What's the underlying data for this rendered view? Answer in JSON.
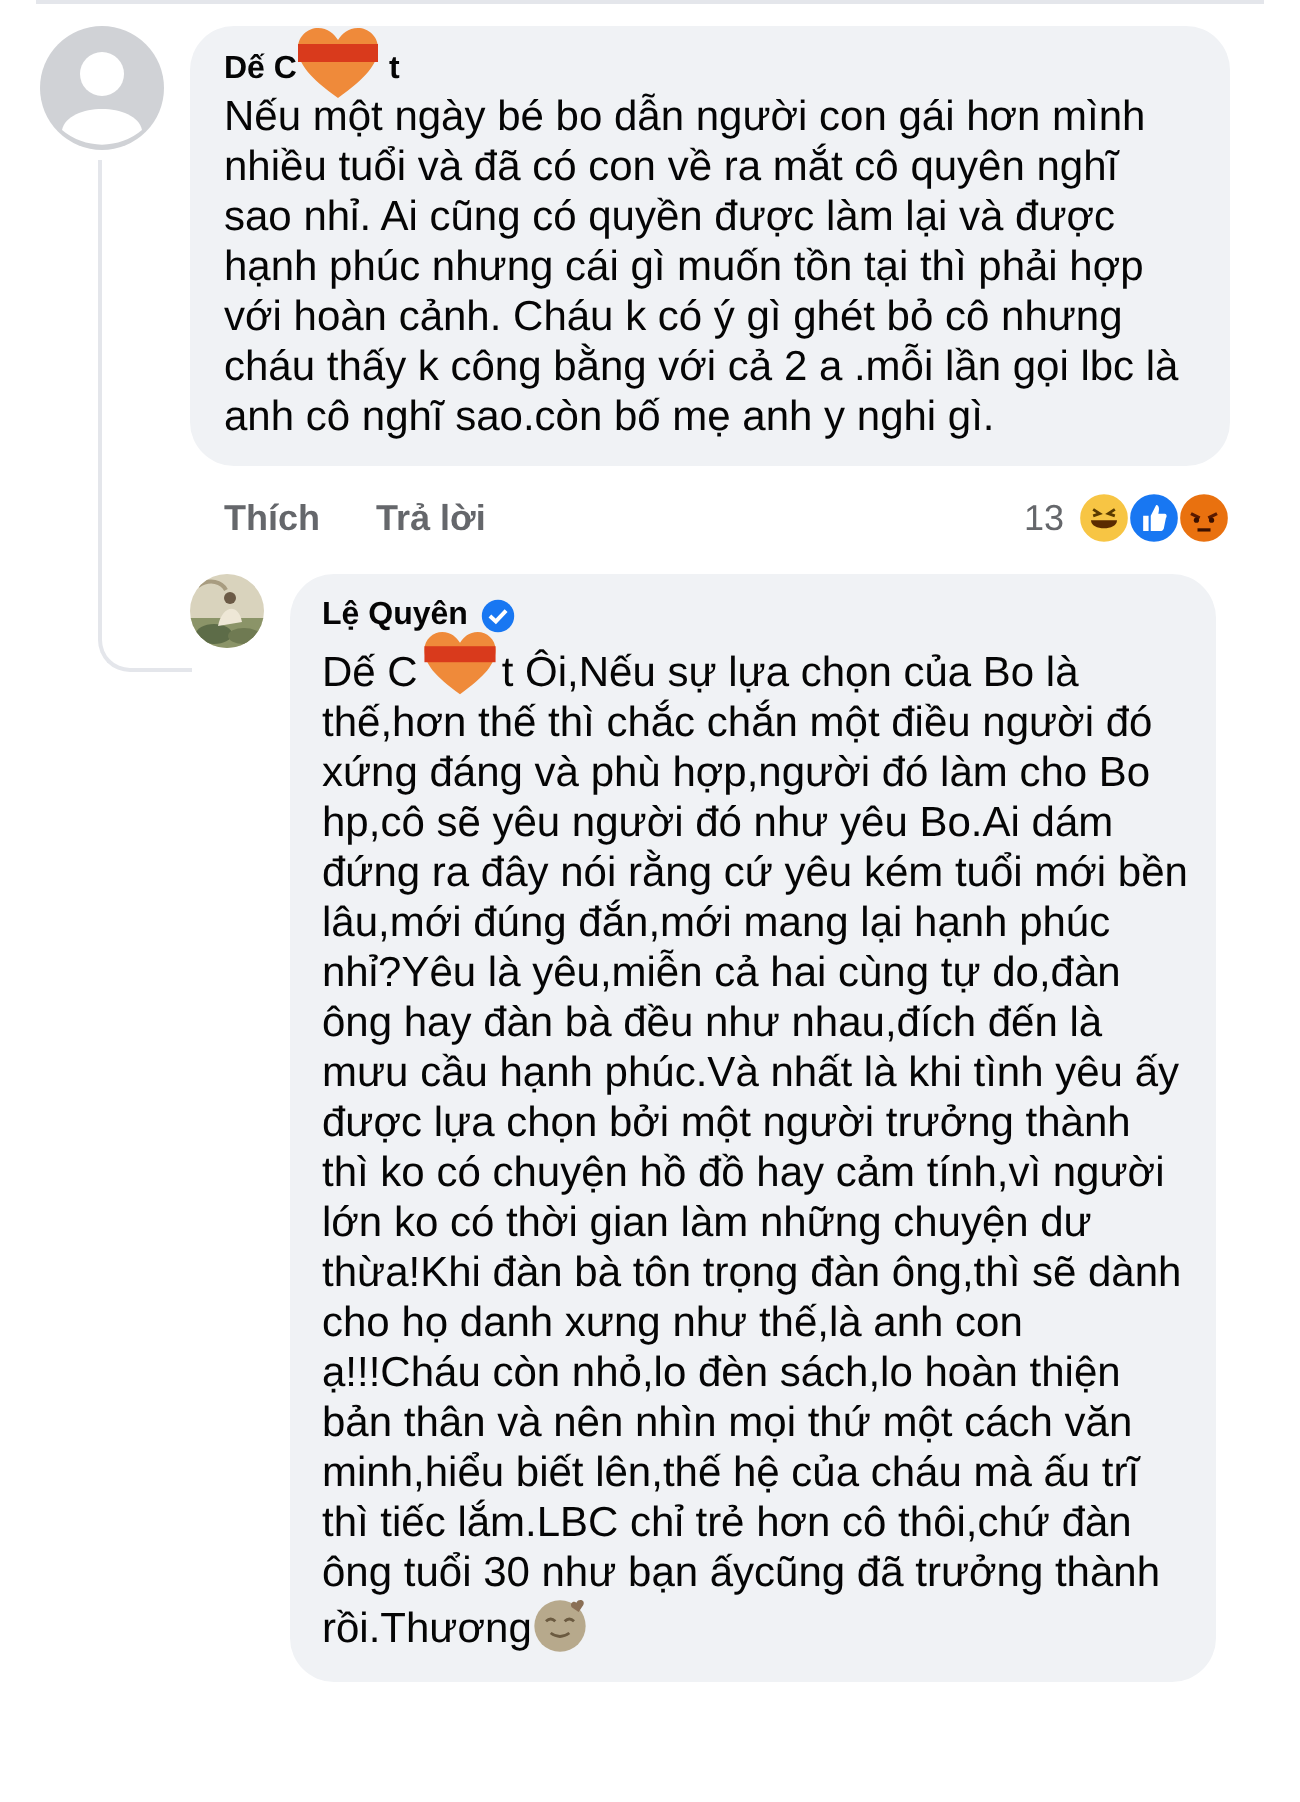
{
  "comment": {
    "author_parts": [
      "Dế C",
      "t"
    ],
    "text": "Nếu một ngày bé bo dẫn người con gái hơn mình nhiều tuổi và đã có con về ra mắt cô quyên nghĩ sao nhỉ. Ai cũng có quyền được làm lại và được hạnh phúc nhưng cái gì muốn tồn tại thì phải hợp với hoàn cảnh. Cháu k có ý gì ghét bỏ cô nhưng cháu thấy k công bằng với cả 2 a .mỗi  lần  gọi lbc là anh cô nghĩ sao.còn bố mẹ anh y nghi gì.",
    "actions": [
      "Thích",
      "Trả lời"
    ],
    "reaction_count": "13",
    "reactions": [
      {
        "kind": "haha"
      },
      {
        "kind": "like"
      },
      {
        "kind": "angry"
      }
    ]
  },
  "reply": {
    "author": "Lệ Quyên",
    "verified": true,
    "text_parts": [
      "Dế C",
      "t Ôi,Nếu sự lựa chọn của Bo là thế,hơn thế thì chắc chắn một điều người đó xứng đáng và phù hợp,người đó làm cho Bo hp,cô sẽ yêu người đó như yêu Bo.Ai dám đứng ra đây nói rằng cứ yêu kém tuổi mới bền lâu,mới đúng đắn,mới mang lại hạnh phúc nhỉ?Yêu là yêu,miễn cả hai cùng tự do,đàn ông hay đàn bà đều như nhau,đích đến là mưu cầu hạnh phúc.Và nhất là khi tình yêu ấy được lựa chọn bởi một người trưởng thành thì ko có chuyện hồ đồ hay cảm tính,vì người lớn ko có thời gian làm những chuyện dư thừa!Khi đàn bà tôn trọng đàn ông,thì sẽ dành cho họ danh xưng như thế,là anh con ạ!!!Cháu còn nhỏ,lo đèn sách,lo hoàn thiện bản thân và nên nhìn mọi thứ một cách văn minh,hiểu biết lên,thế hệ của cháu mà ấu trĩ thì tiếc lắm.LBC chỉ trẻ hơn cô thôi,chứ đàn ông tuổi 30 như bạn ấycũng đã trưởng thành rồi.Thương"
    ]
  }
}
